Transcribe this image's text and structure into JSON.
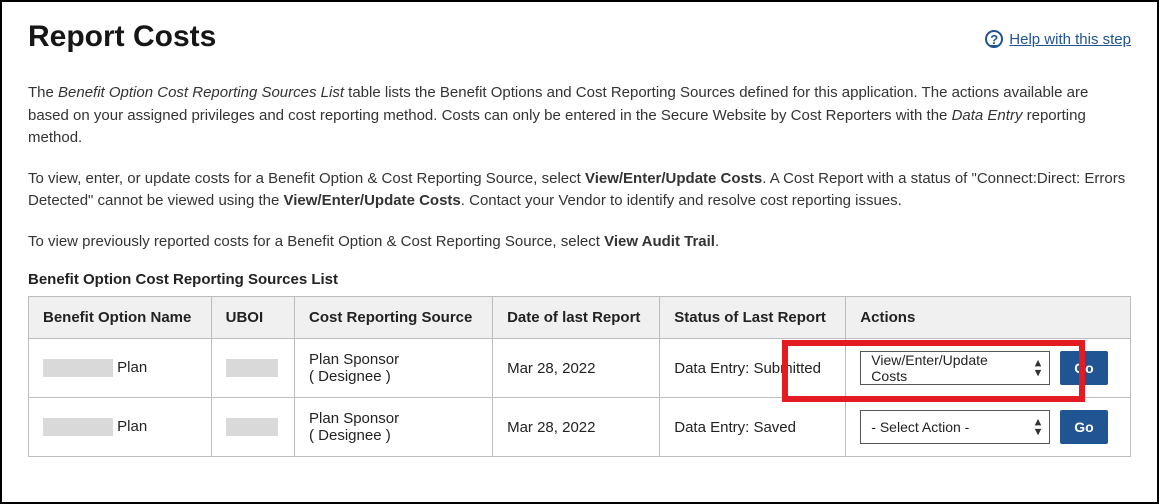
{
  "header": {
    "title": "Report Costs",
    "help_label": "Help with this step"
  },
  "intro": {
    "p1_italic": "Benefit Option Cost Reporting Sources List",
    "p1_after": " table lists the Benefit Options and Cost Reporting Sources defined for this application. The actions available are based on your assigned privileges and cost reporting method. Costs can only be entered in the Secure Website by Cost Reporters with the ",
    "p1_italic2": "Data Entry",
    "p1_tail": " reporting method.",
    "p1_lead": "The ",
    "p2_lead": "To view, enter, or update costs for a Benefit Option & Cost Reporting Source, select ",
    "p2_bold": "View/Enter/Update Costs",
    "p2_mid": ". A Cost Report with a status of \"Connect:Direct: Errors Detected\" cannot be viewed using the ",
    "p2_bold2": "View/Enter/Update Costs",
    "p2_tail": ". Contact your Vendor to identify and resolve cost reporting issues.",
    "p3_lead": "To view previously reported costs for a Benefit Option & Cost Reporting Source, select ",
    "p3_bold": "View Audit Trail",
    "p3_tail": "."
  },
  "table": {
    "label": "Benefit Option Cost Reporting Sources List",
    "headers": {
      "benefit_option": "Benefit Option Name",
      "uboi": "UBOI",
      "source": "Cost Reporting Source",
      "date": "Date of last Report",
      "status": "Status of Last Report",
      "actions": "Actions"
    },
    "rows": [
      {
        "plan_suffix": " Plan",
        "source_line1": "Plan Sponsor",
        "source_line2": "( Designee )",
        "date": "Mar 28, 2022",
        "status": "Data Entry: Submitted",
        "action_selected": "View/Enter/Update Costs",
        "go_label": "Go"
      },
      {
        "plan_suffix": " Plan",
        "source_line1": "Plan Sponsor",
        "source_line2": "( Designee )",
        "date": "Mar 28, 2022",
        "status": "Data Entry: Saved",
        "action_selected": "- Select Action -",
        "go_label": "Go"
      }
    ]
  }
}
